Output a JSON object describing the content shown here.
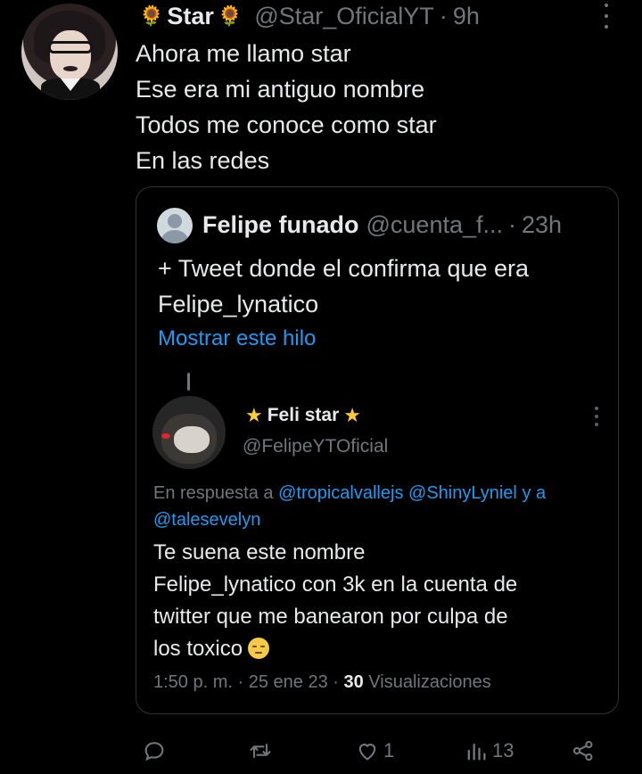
{
  "tweet": {
    "author_name": "Star",
    "author_handle": "@Star_OficialYT",
    "separator": "·",
    "time": "9h",
    "lines": [
      "Ahora me llamo star",
      "Ese era mi antiguo nombre",
      "Todos me conoce como star",
      "En las redes"
    ]
  },
  "quote": {
    "author_name": "Felipe funado",
    "author_handle": "@cuenta_f...",
    "separator": "·",
    "time": "23h",
    "lines": [
      "+ Tweet donde el confirma que era",
      "Felipe_lynatico"
    ],
    "show_thread": "Mostrar este hilo",
    "inner": {
      "author_name": "Feli star",
      "author_handle": "@FelipeYTOficial",
      "reply_prefix": "En respuesta a",
      "reply_mentions": [
        "@tropicalvallejs",
        "@ShinyLyniel"
      ],
      "reply_and": "y a",
      "reply_last": "@talesevelyn",
      "lines": [
        "Te suena este nombre",
        "Felipe_lynatico con 3k en la cuenta de",
        "twitter que me banearon por culpa de",
        "los toxico"
      ],
      "time": "1:50 p. m.",
      "date": "25 ene 23",
      "views_count": "30",
      "views_label": "Visualizaciones"
    }
  },
  "actions": {
    "likes": "1",
    "views": "13"
  }
}
